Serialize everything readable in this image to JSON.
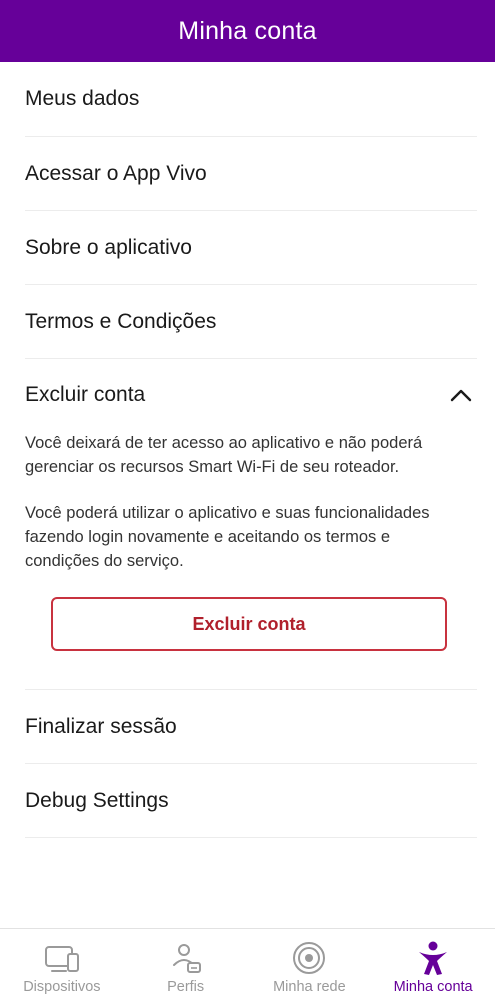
{
  "header": {
    "title": "Minha conta"
  },
  "menu": {
    "items": [
      {
        "label": "Meus dados"
      },
      {
        "label": "Acessar o App Vivo"
      },
      {
        "label": "Sobre o aplicativo"
      },
      {
        "label": "Termos e Condições"
      }
    ],
    "delete_account": {
      "label": "Excluir conta",
      "expanded": true,
      "paragraph_1": "Você deixará de ter acesso ao aplicativo e não poderá gerenciar os recursos Smart Wi-Fi de seu roteador.",
      "paragraph_2": "Você poderá utilizar o aplicativo e suas funcionalidades fazendo login novamente e aceitando os termos e condições do serviço.",
      "button_label": "Excluir conta"
    },
    "after_items": [
      {
        "label": "Finalizar sessão"
      },
      {
        "label": "Debug Settings"
      }
    ]
  },
  "bottom_nav": [
    {
      "label": "Dispositivos",
      "icon": "devices-icon",
      "active": false
    },
    {
      "label": "Perfis",
      "icon": "profiles-icon",
      "active": false
    },
    {
      "label": "Minha rede",
      "icon": "network-icon",
      "active": false
    },
    {
      "label": "Minha conta",
      "icon": "account-icon",
      "active": true
    }
  ],
  "colors": {
    "brand": "#660099",
    "danger": "#c8323f",
    "inactive": "#9a9a9a"
  }
}
